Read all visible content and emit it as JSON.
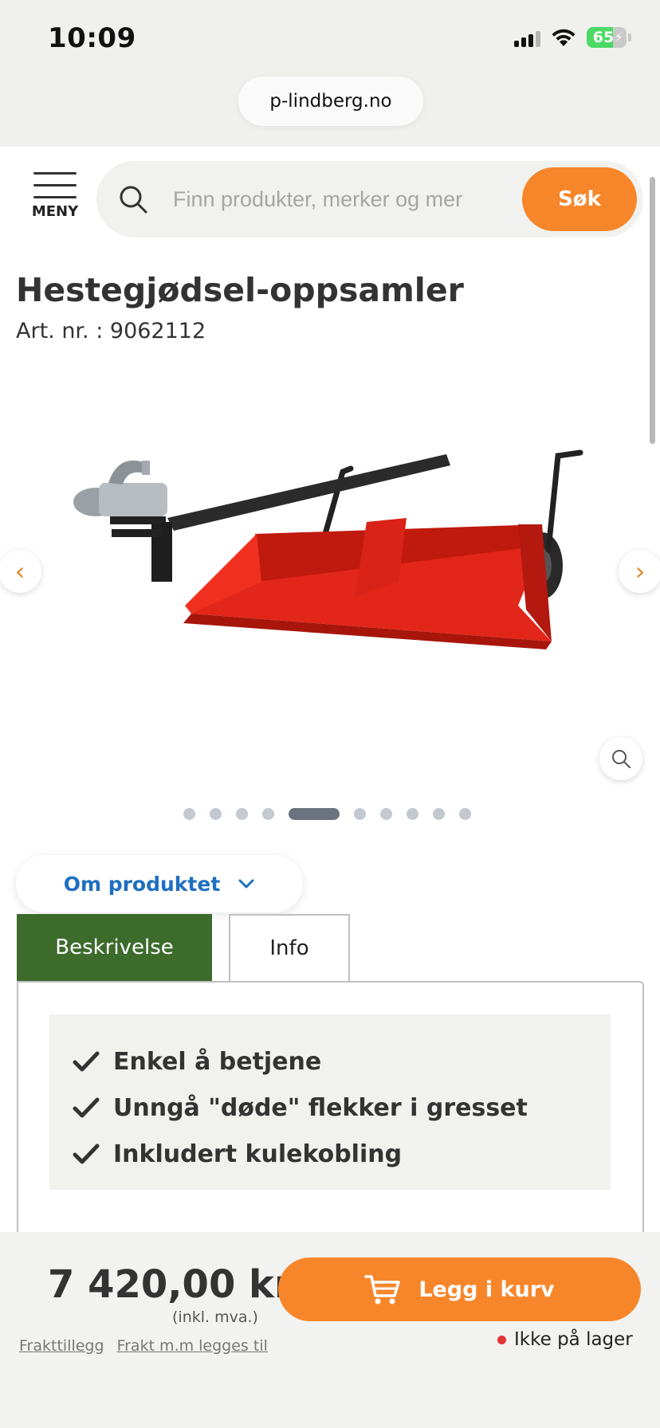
{
  "status_bar": {
    "time": "10:09",
    "battery": "65",
    "battery_level": 0.65
  },
  "browser": {
    "url": "p-lindberg.no"
  },
  "header": {
    "menu_label": "MENY",
    "search_placeholder": "Finn produkter, merker og mer",
    "search_button": "Søk"
  },
  "product": {
    "title": "Hestegjødsel-oppsamler",
    "art_nr": "Art. nr. : 9062112",
    "gallery": {
      "dot_count": 10,
      "active_index": 4
    }
  },
  "about": {
    "label": "Om produktet"
  },
  "tabs": [
    {
      "label": "Beskrivelse",
      "active": true
    },
    {
      "label": "Info",
      "active": false
    }
  ],
  "features": [
    "Enkel å betjene",
    "Unngå \"døde\" flekker i gresset",
    "Inkludert kulekobling"
  ],
  "purchase": {
    "price": "7 420,00 kr",
    "vat_note": "(inkl. mva.)",
    "link_freight_fee": "Frakttillegg",
    "link_freight_note": "Frakt m.m legges til",
    "cart_button": "Legg i kurv",
    "stock_status": "Ikke på lager"
  },
  "colors": {
    "accent": "#f7862a",
    "tab_active": "#3c6b2c",
    "link": "#1f6fbf",
    "stock_red": "#e23232"
  }
}
